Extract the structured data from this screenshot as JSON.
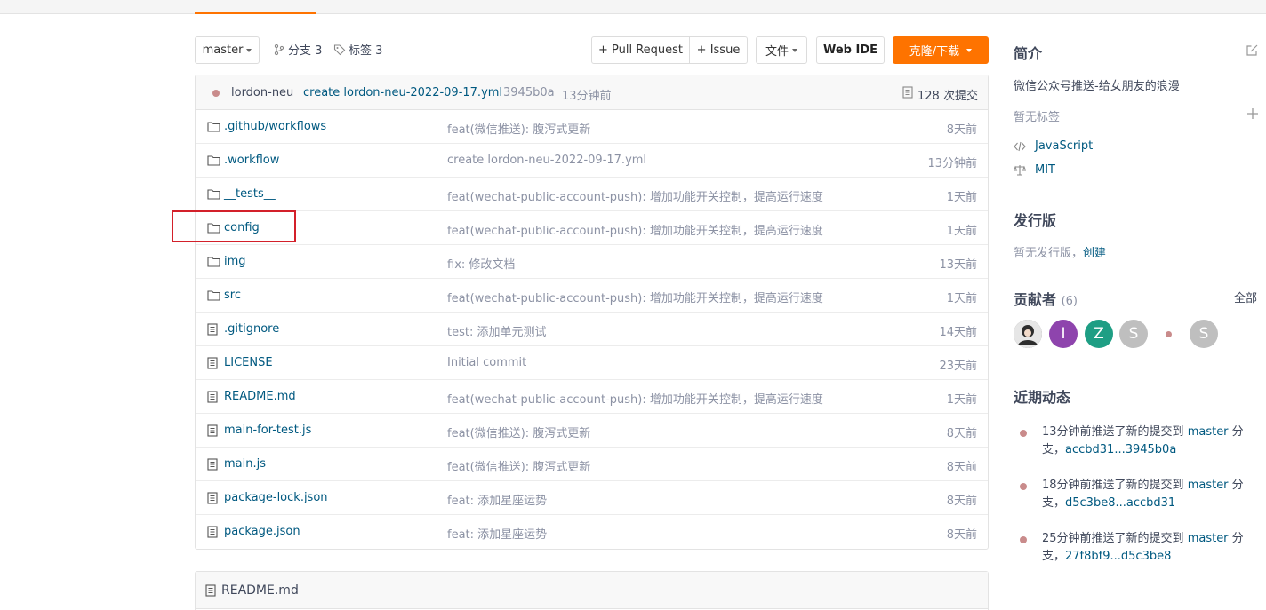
{
  "toolbar": {
    "branch": "master",
    "branches_label": "分支 3",
    "tags_label": "标签 3",
    "pull_request": "+ Pull Request",
    "issue": "+ Issue",
    "files": "文件",
    "web_ide": "Web IDE",
    "clone": "克隆/下载"
  },
  "commit": {
    "author": "lordon-neu",
    "message": "create lordon-neu-2022-09-17.yml",
    "hash": "3945b0a",
    "time": "13分钟前",
    "count": "128 次提交"
  },
  "files": [
    {
      "name": ".github/workflows",
      "type": "folder",
      "message": "feat(微信推送): 腹泻式更新",
      "time": "8天前"
    },
    {
      "name": ".workflow",
      "type": "folder",
      "message": "create lordon-neu-2022-09-17.yml",
      "time": "13分钟前"
    },
    {
      "name": "__tests__",
      "type": "folder",
      "message": "feat(wechat-public-account-push): 增加功能开关控制，提高运行速度",
      "time": "1天前"
    },
    {
      "name": "config",
      "type": "folder",
      "message": "feat(wechat-public-account-push): 增加功能开关控制，提高运行速度",
      "time": "1天前"
    },
    {
      "name": "img",
      "type": "folder",
      "message": "fix: 修改文档",
      "time": "13天前"
    },
    {
      "name": "src",
      "type": "folder",
      "message": "feat(wechat-public-account-push): 增加功能开关控制，提高运行速度",
      "time": "1天前"
    },
    {
      "name": ".gitignore",
      "type": "file",
      "message": "test: 添加单元测试",
      "time": "14天前"
    },
    {
      "name": "LICENSE",
      "type": "file",
      "message": "Initial commit",
      "time": "23天前"
    },
    {
      "name": "README.md",
      "type": "file",
      "message": "feat(wechat-public-account-push): 增加功能开关控制，提高运行速度",
      "time": "1天前"
    },
    {
      "name": "main-for-test.js",
      "type": "file",
      "message": "feat(微信推送): 腹泻式更新",
      "time": "8天前"
    },
    {
      "name": "main.js",
      "type": "file",
      "message": "feat(微信推送): 腹泻式更新",
      "time": "8天前"
    },
    {
      "name": "package-lock.json",
      "type": "file",
      "message": "feat: 添加星座运势",
      "time": "8天前"
    },
    {
      "name": "package.json",
      "type": "file",
      "message": "feat: 添加星座运势",
      "time": "8天前"
    }
  ],
  "readme": {
    "title": "README.md"
  },
  "sidebar": {
    "intro_title": "简介",
    "description": "微信公众号推送-给女朋友的浪漫",
    "no_tags": "暂无标签",
    "language": "JavaScript",
    "license": "MIT",
    "release_title": "发行版",
    "no_release": "暂无发行版，",
    "create": "创建",
    "contrib_title": "贡献者",
    "contrib_count": "(6)",
    "all": "全部",
    "contributors": [
      {
        "letter": "",
        "color": "#6b6b6b"
      },
      {
        "letter": "I",
        "color": "#8e44ad"
      },
      {
        "letter": "Z",
        "color": "#1e9e84"
      },
      {
        "letter": "S",
        "color": "#bfbfbf"
      },
      {
        "letter": "",
        "color": "#ffffff"
      },
      {
        "letter": "S",
        "color": "#bfbfbf"
      }
    ],
    "activity_title": "近期动态",
    "activities": [
      {
        "text": "13分钟前推送了新的提交到 ",
        "branch": "master",
        "suffix": " 分支，",
        "range": "accbd31...3945b0a"
      },
      {
        "text": "18分钟前推送了新的提交到 ",
        "branch": "master",
        "suffix": " 分支，",
        "range": "d5c3be8...accbd31"
      },
      {
        "text": "25分钟前推送了新的提交到 ",
        "branch": "master",
        "suffix": " 分支，",
        "range": "27f8bf9...d5c3be8"
      }
    ]
  },
  "colors": {
    "accent": "#fe7300",
    "link": "#005980",
    "highlight": "#d3202a"
  }
}
